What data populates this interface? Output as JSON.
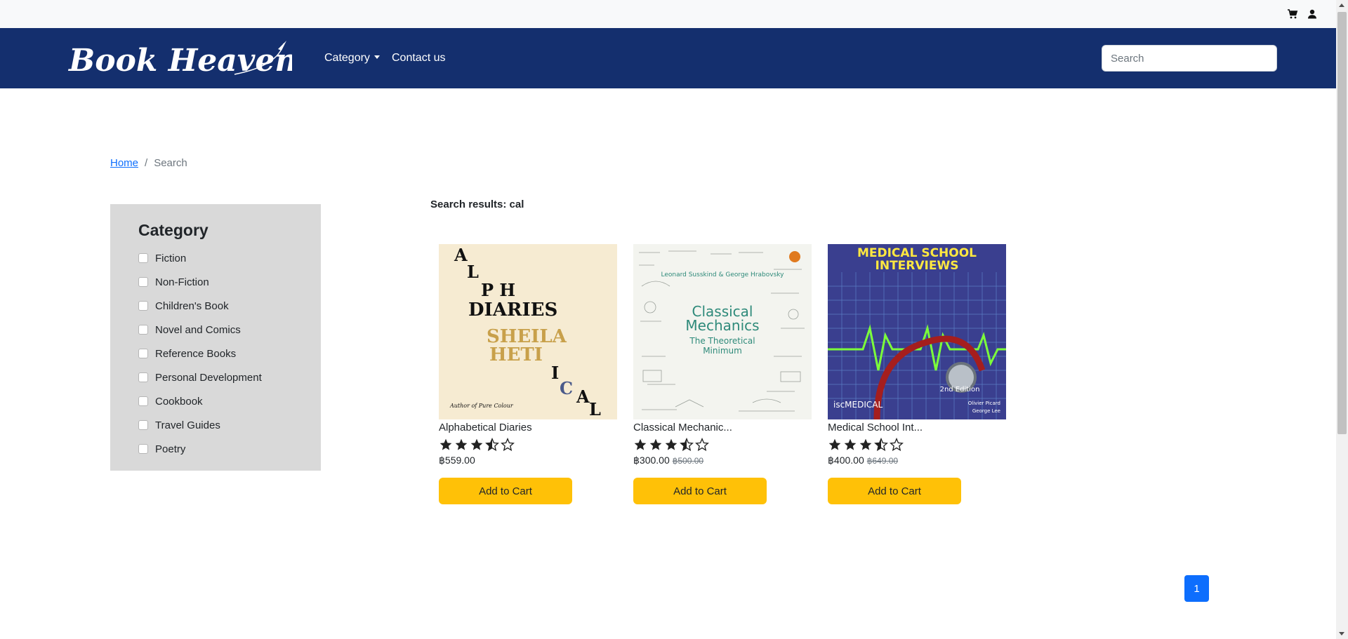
{
  "topbar": {
    "cart_icon": "cart-icon",
    "user_icon": "user-icon"
  },
  "navbar": {
    "logo_text": "Book Heaven",
    "links": [
      {
        "label": "Category",
        "has_dropdown": true
      },
      {
        "label": "Contact us",
        "has_dropdown": false
      }
    ],
    "search_placeholder": "Search",
    "background_color": "#142f6e"
  },
  "breadcrumb": {
    "home": "Home",
    "separator": "/",
    "current": "Search"
  },
  "sidebar": {
    "title": "Category",
    "categories": [
      "Fiction",
      "Non-Fiction",
      "Children's Book",
      "Novel and Comics",
      "Reference Books",
      "Personal Development",
      "Cookbook",
      "Travel Guides",
      "Poetry"
    ]
  },
  "results": {
    "heading": "Search results: cal",
    "books": [
      {
        "title": "Alphabetical Diaries",
        "rating": 3.5,
        "price": "฿559.00",
        "old_price": "",
        "button": "Add to Cart",
        "cover": {
          "lines": [
            "A",
            "L",
            "P H",
            "DIARIES",
            "SHEILA",
            "HETI",
            "I",
            "C",
            "A",
            "L"
          ],
          "footer": "Author of Pure Colour"
        }
      },
      {
        "title": "Classical Mechanic...",
        "rating": 3.5,
        "price": "฿300.00",
        "old_price": "฿500.00",
        "button": "Add to Cart",
        "cover": {
          "authors": "Leonard Susskind & George Hrabovsky",
          "title_line1": "Classical",
          "title_line2": "Mechanics",
          "subtitle_line1": "The Theoretical",
          "subtitle_line2": "Minimum"
        }
      },
      {
        "title": "Medical School Int...",
        "rating": 3.5,
        "price": "฿400.00",
        "old_price": "฿649.00",
        "button": "Add to Cart",
        "cover": {
          "title_line1": "MEDICAL SCHOOL",
          "title_line2": "INTERVIEWS",
          "edition": "2nd Edition",
          "publisher": "iscMEDICAL",
          "author1": "Olivier Picard",
          "author2": "George Lee"
        }
      }
    ]
  },
  "pagination": {
    "current": "1"
  },
  "colors": {
    "accent_button": "#ffc107",
    "link": "#0d6efd",
    "sidebar_bg": "#d9d9d9"
  }
}
